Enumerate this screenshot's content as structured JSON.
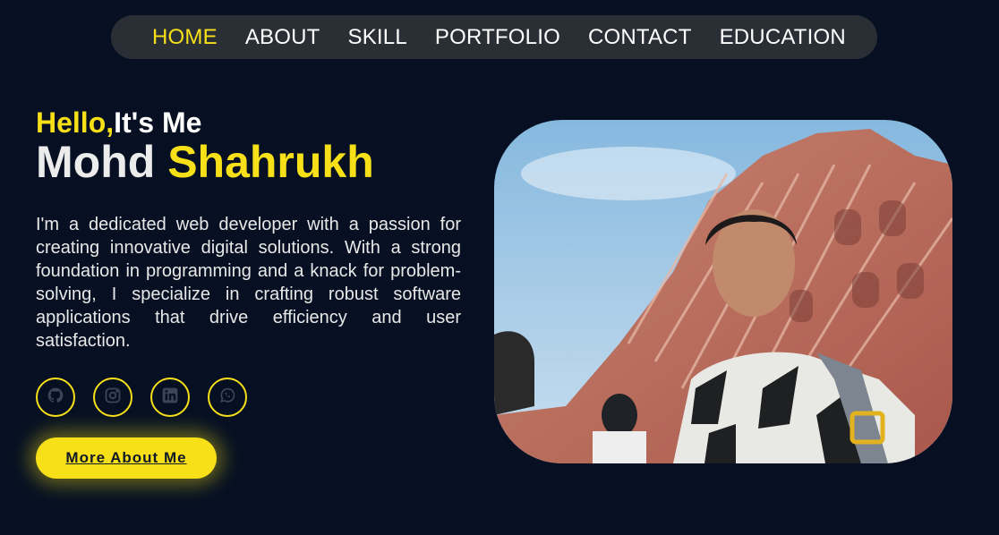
{
  "nav": {
    "items": [
      {
        "label": "HOME",
        "active": true
      },
      {
        "label": "ABOUT",
        "active": false
      },
      {
        "label": "SKILL",
        "active": false
      },
      {
        "label": "PORTFOLIO",
        "active": false
      },
      {
        "label": "CONTACT",
        "active": false
      },
      {
        "label": "EDUCATION",
        "active": false
      }
    ]
  },
  "hero": {
    "greeting_hello": "Hello,",
    "greeting_rest": "It's Me",
    "name_first": "Mohd",
    "name_last": "Shahrukh",
    "bio": "I'm a dedicated web developer with a passion for creating innovative digital solutions. With a strong foundation in programming and a knack for problem-solving, I specialize in crafting robust software applications that drive efficiency and user satisfaction.",
    "cta_label": "More About Me",
    "photo_alt": "profile-photo"
  },
  "socials": [
    {
      "icon": "github-icon"
    },
    {
      "icon": "instagram-icon"
    },
    {
      "icon": "linkedin-icon"
    },
    {
      "icon": "whatsapp-icon"
    }
  ],
  "colors": {
    "background": "#061022",
    "accent": "#f7e018",
    "nav_bg": "#2a2f36",
    "text": "#ffffff"
  }
}
